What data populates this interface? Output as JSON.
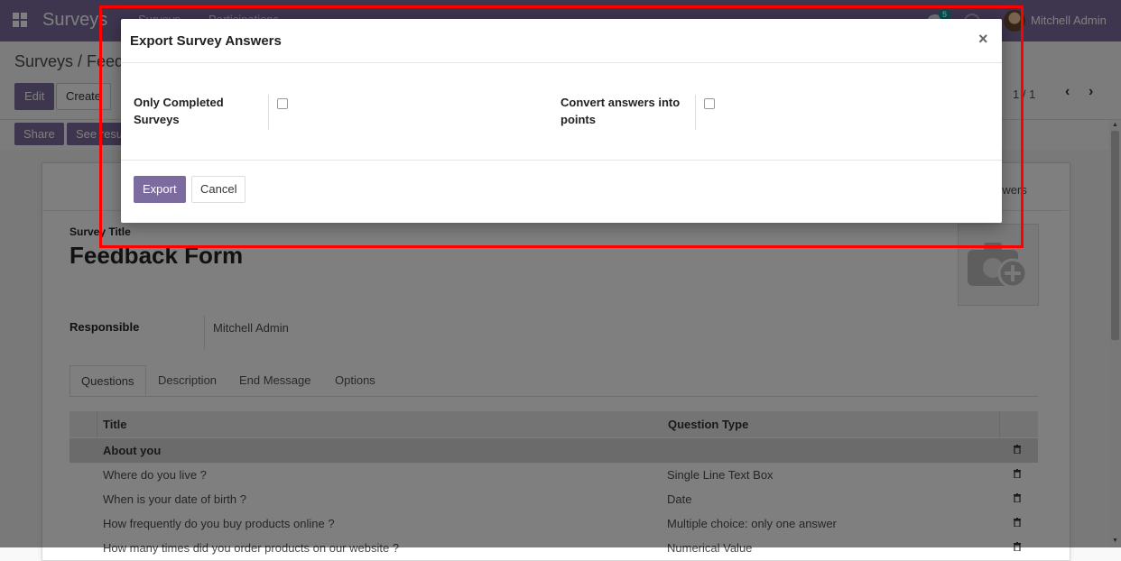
{
  "navbar": {
    "brand": "Surveys",
    "menu": [
      "Surveys",
      "Participations"
    ],
    "notification_count": "5",
    "user_name": "Mitchell Admin"
  },
  "control_panel": {
    "breadcrumb": "Surveys / Feedback Form",
    "edit_label": "Edit",
    "create_label": "Create",
    "pager_value": "1 / 1",
    "share_label": "Share",
    "see_results_label": "See results"
  },
  "form": {
    "stat_button_label": "Answers",
    "title_label": "Survey Title",
    "title_value": "Feedback Form",
    "responsible_label": "Responsible",
    "responsible_value": "Mitchell Admin",
    "tabs": [
      "Questions",
      "Description",
      "End Message",
      "Options"
    ],
    "table": {
      "headers": [
        "Title",
        "Question Type"
      ],
      "rows": [
        {
          "title": "About you",
          "type": "",
          "section": true
        },
        {
          "title": "Where do you live ?",
          "type": "Single Line Text Box",
          "section": false
        },
        {
          "title": "When is your date of birth ?",
          "type": "Date",
          "section": false
        },
        {
          "title": "How frequently do you buy products online ?",
          "type": "Multiple choice: only one answer",
          "section": false
        },
        {
          "title": "How many times did you order products on our website ?",
          "type": "Numerical Value",
          "section": false
        }
      ]
    }
  },
  "modal": {
    "title": "Export Survey Answers",
    "close_symbol": "×",
    "field1_label": "Only Completed Surveys",
    "field1_checked": false,
    "field2_label": "Convert answers into points",
    "field2_checked": false,
    "export_label": "Export",
    "cancel_label": "Cancel"
  },
  "colors": {
    "brand": "#7c6b9f",
    "highlight": "#ff0000",
    "badge": "#00a09d"
  }
}
